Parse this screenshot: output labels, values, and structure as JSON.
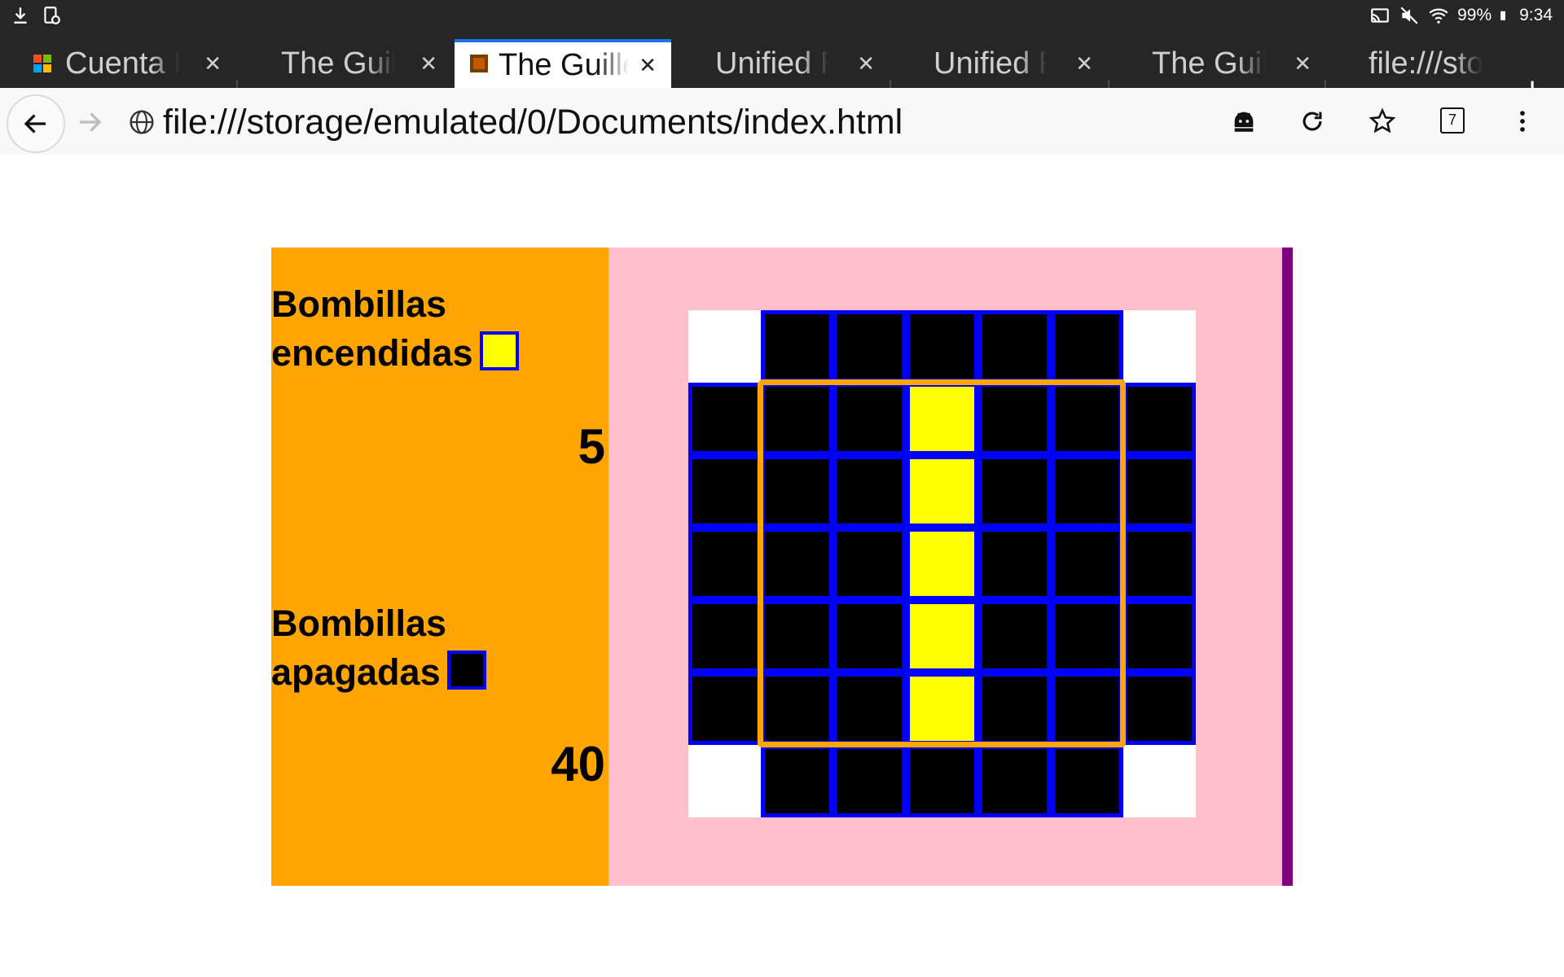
{
  "status_bar": {
    "battery": "99%",
    "time": "9:34",
    "left_icons": [
      "download-icon",
      "screenshot-icon"
    ],
    "right_icons": [
      "cast-icon",
      "mute-icon",
      "wifi-icon",
      "battery-icon"
    ]
  },
  "tabs": [
    {
      "title": "Cuenta M",
      "favicon": "microsoft-logo",
      "active": false
    },
    {
      "title": "The Guill",
      "favicon": "",
      "active": false
    },
    {
      "title": "The Guille",
      "favicon": "page-favicon",
      "active": true
    },
    {
      "title": "Unified R",
      "favicon": "",
      "active": false
    },
    {
      "title": "Unified R",
      "favicon": "",
      "active": false
    },
    {
      "title": "The Guill",
      "favicon": "",
      "active": false
    },
    {
      "title": "file:///sto",
      "favicon": "",
      "active": false
    }
  ],
  "toolbar": {
    "url": "file:///storage/emulated/0/Documents/index.html",
    "tab_count": "7"
  },
  "panel": {
    "on_label_line1": "Bombillas",
    "on_label_line2": "encendidas",
    "on_count": "5",
    "off_label_line1": "Bombillas",
    "off_label_line2": "apagadas",
    "off_count": "40"
  },
  "colors": {
    "left_panel": "#ffa500",
    "right_panel": "#ffc0cb",
    "right_border": "#800080",
    "bulb_on": "#ffff00",
    "bulb_off": "#000000",
    "cell_border": "#0000ff",
    "highlight_line": "#ffa500"
  },
  "grid": {
    "rows": [
      [
        "empty",
        "off",
        "off",
        "off",
        "off",
        "off",
        "empty"
      ],
      [
        "off",
        "off",
        "off",
        "on",
        "off",
        "off",
        "off"
      ],
      [
        "off",
        "off",
        "off",
        "on",
        "off",
        "off",
        "off"
      ],
      [
        "off",
        "off",
        "off",
        "on",
        "off",
        "off",
        "off"
      ],
      [
        "off",
        "off",
        "off",
        "on",
        "off",
        "off",
        "off"
      ],
      [
        "off",
        "off",
        "off",
        "on",
        "off",
        "off",
        "off"
      ],
      [
        "empty",
        "off",
        "off",
        "off",
        "off",
        "off",
        "empty"
      ]
    ]
  }
}
